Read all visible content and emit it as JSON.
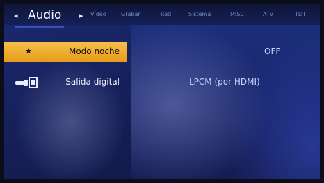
{
  "header": {
    "title": "Audio",
    "tabs": [
      "Vídeo",
      "Grabar",
      "Red",
      "Sistema",
      "MISC",
      "ATV",
      "TDT"
    ]
  },
  "settings": [
    {
      "label": "Modo noche",
      "value": "OFF",
      "icon": "moon-star-icon",
      "active": true
    },
    {
      "label": "Salida digital",
      "value": "LPCM (por HDMI)",
      "icon": "digital-output-icon",
      "active": false
    }
  ],
  "colors": {
    "accent": "#f0b43a",
    "background": "#16205a",
    "value_text": "#c8d0ff"
  }
}
